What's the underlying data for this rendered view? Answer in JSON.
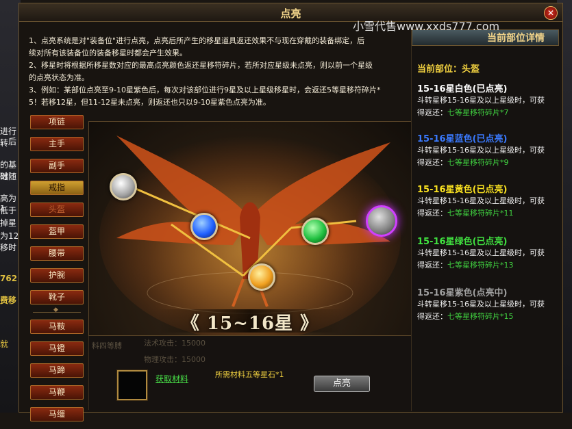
{
  "window": {
    "title": "点亮",
    "close_symbol": "✕"
  },
  "watermark": "小雪代售www.xxds777.com",
  "background_left_fragments": [
    "进行转",
    "，后",
    "的基础",
    "时随",
    "高为1",
    "低于",
    "掉星",
    "为12",
    "移时",
    "762",
    "费移",
    "就"
  ],
  "description": [
    "1、点亮系统是对\"装备位\"进行点亮，点亮后所产生的移星道具返还效果不与现在穿戴的装备绑定，后",
    "续对所有该装备位的装备移星时都会产生效果。",
    "2、移星时将根据所移星数对应的最高点亮颜色返还星移符碎片，若所对应星级未点亮，则以前一个星级",
    "的点亮状态为准。",
    "3、例如：某部位点亮至9-10星紫色后，每次对该部位进行9星及以上星级移星时，会返还5等星移符碎片*",
    "5！若移12星，但11-12星未点亮，则返还也只以9-10星紫色点亮为准。"
  ],
  "nav": {
    "equip": [
      "项链",
      "主手",
      "副手",
      "戒指",
      "头盔",
      "盔甲",
      "腰带",
      "护腕",
      "靴子"
    ],
    "mount": [
      "马鞍",
      "马镫",
      "马蹄",
      "马鞭",
      "马缰"
    ],
    "active_index": 3,
    "dim_index": 4
  },
  "stage": {
    "star_range": "《 15~16星 》"
  },
  "orbs": [
    {
      "name": "white",
      "color": "#f0f0f0"
    },
    {
      "name": "blue",
      "color": "#2070ff"
    },
    {
      "name": "yellow",
      "color": "#f0b020"
    },
    {
      "name": "green",
      "color": "#20c040"
    },
    {
      "name": "purple",
      "color": "#c030ff"
    }
  ],
  "bottom": {
    "ghost_1": "料四等膊",
    "ghost_2": "法术攻击：15000",
    "ghost_3": "物理攻击：15000",
    "material_link": "获取材料",
    "material_req": "所需材料五等星石*1",
    "light_button": "点亮"
  },
  "right": {
    "header": "当前部位详情",
    "part_label": "当前部位：头盔",
    "entries": [
      {
        "name": "15-16星白色(已点亮)",
        "color": "#ffffff",
        "line1": "斗转星移15-16星及以上星级时，可获",
        "line2_prefix": "得返还：",
        "reward": "七等星移符碎片*7"
      },
      {
        "name": "15-16星蓝色(已点亮)",
        "color": "#3a7aff",
        "line1": "斗转星移15-16星及以上星级时，可获",
        "line2_prefix": "得返还：",
        "reward": "七等星移符碎片*9"
      },
      {
        "name": "15-16星黄色(已点亮)",
        "color": "#f8e020",
        "line1": "斗转星移15-16星及以上星级时，可获",
        "line2_prefix": "得返还：",
        "reward": "七等星移符碎片*11"
      },
      {
        "name": "15-16星绿色(已点亮)",
        "color": "#40e040",
        "line1": "斗转星移15-16星及以上星级时，可获",
        "line2_prefix": "得返还：",
        "reward": "七等星移符碎片*13"
      },
      {
        "name": "15-16星紫色(点亮中)",
        "color": "#a0a0a0",
        "line1": "斗转星移15-16星及以上星级时，可获",
        "line2_prefix": "得返还：",
        "reward": "七等星移符碎片*15"
      }
    ]
  }
}
